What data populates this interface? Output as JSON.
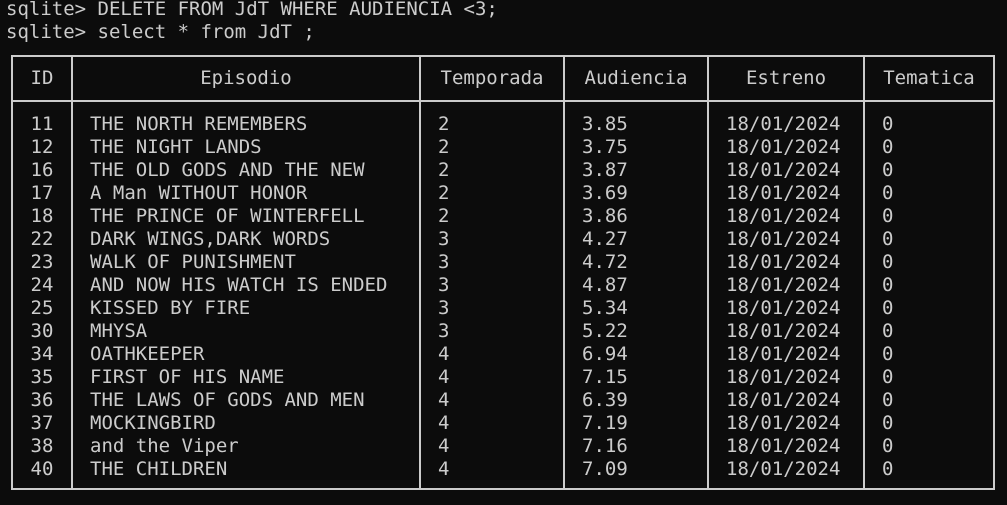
{
  "commands": [
    "sqlite> DELETE FROM JdT WHERE AUDIENCIA <3;",
    "sqlite> select * from JdT ;"
  ],
  "table": {
    "headers": [
      "ID",
      "Episodio",
      "Temporada",
      "Audiencia",
      "Estreno",
      "Tematica"
    ],
    "rows": [
      [
        "11",
        "THE NORTH REMEMBERS",
        "2",
        "3.85",
        "18/01/2024",
        "0"
      ],
      [
        "12",
        "THE NIGHT LANDS",
        "2",
        "3.75",
        "18/01/2024",
        "0"
      ],
      [
        "16",
        "THE OLD GODS AND THE NEW",
        "2",
        "3.87",
        "18/01/2024",
        "0"
      ],
      [
        "17",
        "A Man WITHOUT HONOR",
        "2",
        "3.69",
        "18/01/2024",
        "0"
      ],
      [
        "18",
        "THE PRINCE OF WINTERFELL",
        "2",
        "3.86",
        "18/01/2024",
        "0"
      ],
      [
        "22",
        "DARK WINGS,DARK WORDS",
        "3",
        "4.27",
        "18/01/2024",
        "0"
      ],
      [
        "23",
        "WALK OF PUNISHMENT",
        "3",
        "4.72",
        "18/01/2024",
        "0"
      ],
      [
        "24",
        "AND NOW HIS WATCH IS ENDED",
        "3",
        "4.87",
        "18/01/2024",
        "0"
      ],
      [
        "25",
        "KISSED BY FIRE",
        "3",
        "5.34",
        "18/01/2024",
        "0"
      ],
      [
        "30",
        "MHYSA",
        "3",
        "5.22",
        "18/01/2024",
        "0"
      ],
      [
        "34",
        "OATHKEEPER",
        "4",
        "6.94",
        "18/01/2024",
        "0"
      ],
      [
        "35",
        "FIRST OF HIS NAME",
        "4",
        "7.15",
        "18/01/2024",
        "0"
      ],
      [
        "36",
        "THE LAWS OF GODS AND MEN",
        "4",
        "6.39",
        "18/01/2024",
        "0"
      ],
      [
        "37",
        "MOCKINGBIRD",
        "4",
        "7.19",
        "18/01/2024",
        "0"
      ],
      [
        "38",
        "and the Viper",
        "4",
        "7.16",
        "18/01/2024",
        "0"
      ],
      [
        "40",
        "THE CHILDREN",
        "4",
        "7.09",
        "18/01/2024",
        "0"
      ]
    ]
  }
}
